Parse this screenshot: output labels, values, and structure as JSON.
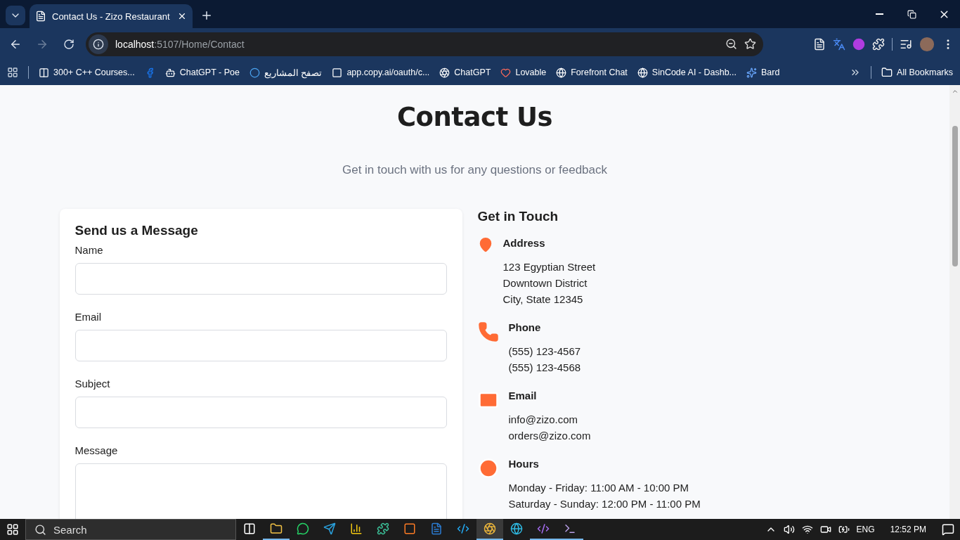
{
  "browser": {
    "tab_title": "Contact Us - Zizo Restaurant",
    "url_host": "localhost",
    "url_path": ":5107/Home/Contact",
    "bookmarks": [
      {
        "kind": "cc",
        "label": "300+ C++ Courses..."
      },
      {
        "kind": "facebook"
      },
      {
        "kind": "bot",
        "label": "ChatGPT - Poe"
      },
      {
        "kind": "ring",
        "label": "تصفح المشاريع"
      },
      {
        "kind": "square",
        "label": "app.copy.ai/oauth/c..."
      },
      {
        "kind": "openai",
        "label": "ChatGPT"
      },
      {
        "kind": "heart",
        "label": "Lovable"
      },
      {
        "kind": "globe",
        "label": "Forefront Chat"
      },
      {
        "kind": "globe",
        "label": "SinCode AI - Dashb..."
      },
      {
        "kind": "spark",
        "label": "Bard"
      }
    ],
    "all_bookmarks": "All Bookmarks"
  },
  "page": {
    "title": "Contact Us",
    "subtitle": "Get in touch with us for any questions or feedback",
    "form": {
      "heading": "Send us a Message",
      "fields": [
        {
          "kind": "input",
          "label": "Name"
        },
        {
          "kind": "input",
          "label": "Email"
        },
        {
          "kind": "input",
          "label": "Subject"
        },
        {
          "kind": "textarea",
          "label": "Message"
        }
      ]
    },
    "contact": {
      "heading": "Get in Touch",
      "items": [
        {
          "kind": "address",
          "title": "Address",
          "lines": [
            "123 Egyptian Street",
            "Downtown District",
            "City, State 12345"
          ]
        },
        {
          "kind": "phone",
          "title": "Phone",
          "lines": [
            "(555) 123-4567",
            "(555) 123-4568"
          ]
        },
        {
          "kind": "email",
          "title": "Email",
          "lines": [
            "info@zizo.com",
            "orders@zizo.com"
          ]
        },
        {
          "kind": "hours",
          "title": "Hours",
          "lines": [
            "Monday - Friday: 11:00 AM - 10:00 PM",
            "Saturday - Sunday: 12:00 PM - 11:00 PM"
          ]
        }
      ]
    }
  },
  "taskbar": {
    "search_placeholder": "Search",
    "apps": [
      {
        "kind": "taskview",
        "running": false,
        "selected": false
      },
      {
        "kind": "folder",
        "running": true,
        "selected": false
      },
      {
        "kind": "whatsapp",
        "running": false,
        "selected": false
      },
      {
        "kind": "telegram",
        "running": false,
        "selected": false
      },
      {
        "kind": "chart",
        "running": false,
        "selected": false
      },
      {
        "kind": "puzzle",
        "running": false,
        "selected": false
      },
      {
        "kind": "xampp",
        "running": false,
        "selected": false
      },
      {
        "kind": "word",
        "running": false,
        "selected": false
      },
      {
        "kind": "code",
        "running": false,
        "selected": false
      },
      {
        "kind": "chrome",
        "running": true,
        "selected": true
      },
      {
        "kind": "edge",
        "running": false,
        "selected": false
      },
      {
        "kind": "studio",
        "running": true,
        "selected": false
      },
      {
        "kind": "terminal",
        "running": true,
        "selected": false
      }
    ],
    "language": "ENG",
    "time": "12:52 PM"
  }
}
